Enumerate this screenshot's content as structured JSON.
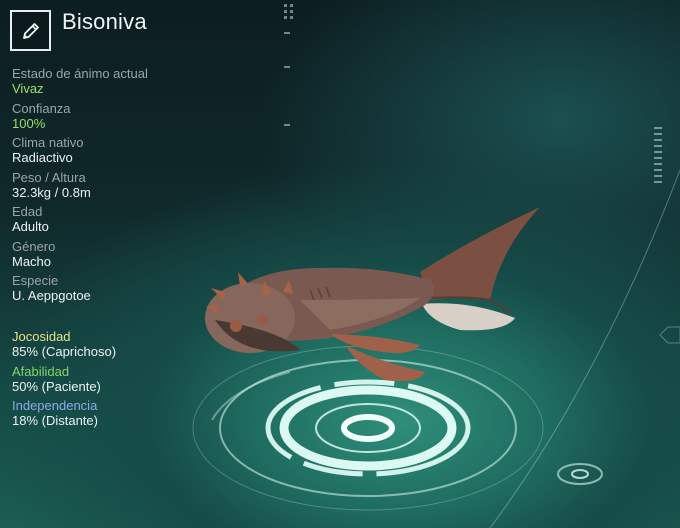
{
  "creature": {
    "name": "Bisoniva"
  },
  "stats": [
    {
      "label": "Estado de ánimo actual",
      "value": "Vivaz",
      "value_color": "#9be06a"
    },
    {
      "label": "Confianza",
      "value": "100%",
      "value_color": "#9be06a"
    },
    {
      "label": "Clima nativo",
      "value": "Radiactivo",
      "value_color": "#eef2f2"
    },
    {
      "label": "Peso / Altura",
      "value": "32.3kg / 0.8m",
      "value_color": "#eef2f2"
    },
    {
      "label": "Edad",
      "value": "Adulto",
      "value_color": "#eef2f2"
    },
    {
      "label": "Género",
      "value": "Macho",
      "value_color": "#eef2f2"
    },
    {
      "label": "Especie",
      "value": "U. Aeppgotoe",
      "value_color": "#eef2f2"
    }
  ],
  "traits": [
    {
      "label": "Jocosidad",
      "value": "85% (Caprichoso)",
      "color": "#e6e08a"
    },
    {
      "label": "Afabilidad",
      "value": "50% (Paciente)",
      "color": "#7fd86a"
    },
    {
      "label": "Independencia",
      "value": "18% (Distante)",
      "color": "#8fa8e8"
    }
  ],
  "icons": {
    "edit": "pencil-icon"
  }
}
